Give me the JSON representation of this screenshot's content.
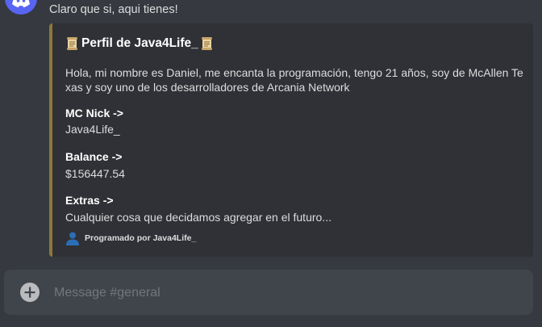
{
  "message": {
    "text": "Claro que si, aqui tienes!"
  },
  "embed": {
    "accent_color": "#8a7a38",
    "title": "Perfil de Java4Life_",
    "title_icon": "scroll-icon",
    "description": "Hola, mi nombre es Daniel, me encanta la programación, tengo 21 años, soy de McAllen Texas y soy uno de los desarrolladores de Arcania Network",
    "fields": [
      {
        "name": "MC Nick ->",
        "value": "Java4Life_"
      },
      {
        "name": "Balance ->",
        "value": "$156447.54"
      },
      {
        "name": "Extras ->",
        "value": "Cualquier cosa que decidamos agregar en el futuro..."
      }
    ],
    "footer": {
      "icon": "user-icon",
      "text": "Programado por Java4Life_"
    }
  },
  "composer": {
    "placeholder": "Message #general",
    "add_icon": "plus-icon"
  },
  "colors": {
    "background": "#36393f",
    "embed_background": "#2f3136",
    "composer_background": "#40444b",
    "avatar": "#5865f2"
  }
}
